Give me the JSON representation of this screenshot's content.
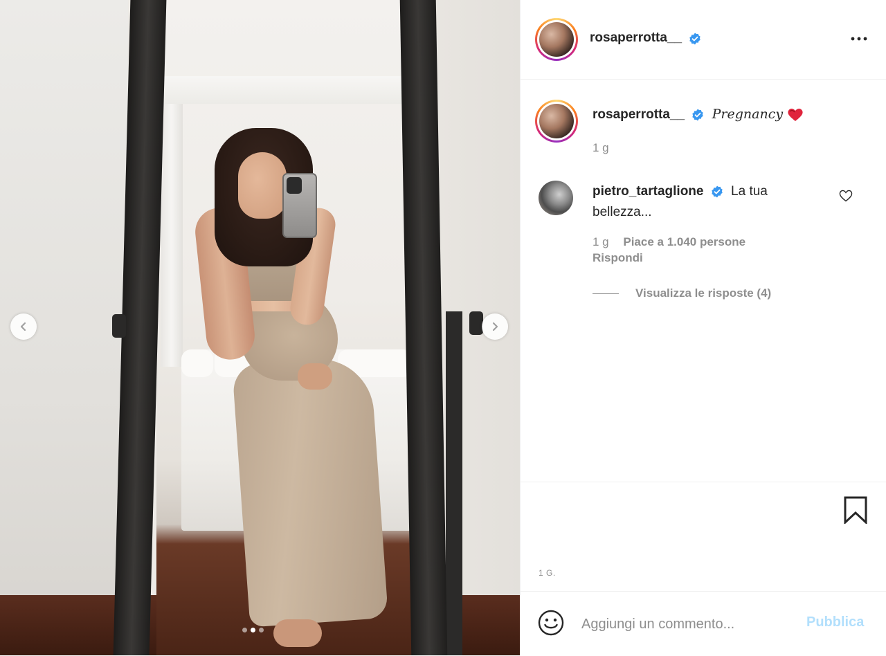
{
  "post": {
    "author": "rosaperrotta__",
    "verified": true,
    "caption": "Pregnancy",
    "caption_emoji": "heart-emoji",
    "caption_time": "1 g",
    "posted_time": "1 G.",
    "carousel": {
      "total": 3,
      "active_index": 1
    }
  },
  "header": {
    "username": "rosaperrotta__",
    "more_icon": "more-options-icon"
  },
  "comments": [
    {
      "username": "pietro_tartaglione",
      "verified": true,
      "text": "La tua bellezza...",
      "time": "1 g",
      "likes": "Piace a 1.040 persone",
      "reply_label": "Rispondi",
      "view_replies": "Visualizza le risposte (4)"
    }
  ],
  "composer": {
    "placeholder": "Aggiungi un commento...",
    "publish_label": "Pubblica"
  },
  "colors": {
    "verified": "#3897f0",
    "publish_disabled": "#b2dffc",
    "muted": "#8e8e8e",
    "text": "#262626"
  }
}
